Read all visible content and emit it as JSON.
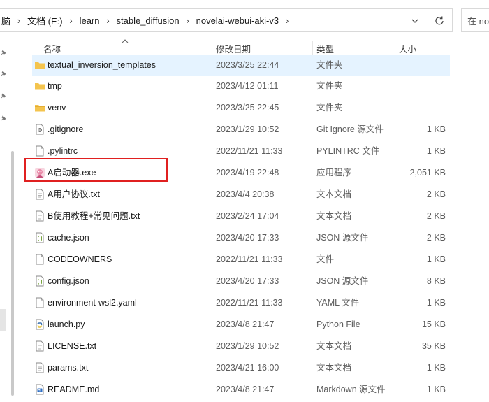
{
  "breadcrumb": [
    "脑",
    "文档 (E:)",
    "learn",
    "stable_diffusion",
    "novelai-webui-aki-v3"
  ],
  "search_placeholder": "在 no",
  "columns": {
    "name": "名称",
    "date": "修改日期",
    "type": "类型",
    "size": "大小"
  },
  "files": [
    {
      "name": "textual_inversion_templates",
      "date": "2023/3/25 22:44",
      "type": "文件夹",
      "size": "",
      "icon": "folder-icon"
    },
    {
      "name": "tmp",
      "date": "2023/4/12 01:11",
      "type": "文件夹",
      "size": "",
      "icon": "folder-icon"
    },
    {
      "name": "venv",
      "date": "2023/3/25 22:45",
      "type": "文件夹",
      "size": "",
      "icon": "folder-icon"
    },
    {
      "name": ".gitignore",
      "date": "2023/1/29 10:52",
      "type": "Git Ignore 源文件",
      "size": "1 KB",
      "icon": "gear-file-icon"
    },
    {
      "name": ".pylintrc",
      "date": "2022/11/21 11:33",
      "type": "PYLINTRC 文件",
      "size": "1 KB",
      "icon": "file-icon"
    },
    {
      "name": "A启动器.exe",
      "date": "2023/4/19 22:48",
      "type": "应用程序",
      "size": "2,051 KB",
      "icon": "app-icon"
    },
    {
      "name": "A用户协议.txt",
      "date": "2023/4/4 20:38",
      "type": "文本文档",
      "size": "2 KB",
      "icon": "text-file-icon"
    },
    {
      "name": "B使用教程+常见问题.txt",
      "date": "2023/2/24 17:04",
      "type": "文本文档",
      "size": "2 KB",
      "icon": "text-file-icon"
    },
    {
      "name": "cache.json",
      "date": "2023/4/20 17:33",
      "type": "JSON 源文件",
      "size": "2 KB",
      "icon": "json-file-icon"
    },
    {
      "name": "CODEOWNERS",
      "date": "2022/11/21 11:33",
      "type": "文件",
      "size": "1 KB",
      "icon": "file-icon"
    },
    {
      "name": "config.json",
      "date": "2023/4/20 17:33",
      "type": "JSON 源文件",
      "size": "8 KB",
      "icon": "json-file-icon"
    },
    {
      "name": "environment-wsl2.yaml",
      "date": "2022/11/21 11:33",
      "type": "YAML 文件",
      "size": "1 KB",
      "icon": "file-icon"
    },
    {
      "name": "launch.py",
      "date": "2023/4/8 21:47",
      "type": "Python File",
      "size": "15 KB",
      "icon": "python-file-icon"
    },
    {
      "name": "LICENSE.txt",
      "date": "2023/1/29 10:52",
      "type": "文本文档",
      "size": "35 KB",
      "icon": "text-file-icon"
    },
    {
      "name": "params.txt",
      "date": "2023/4/21 16:00",
      "type": "文本文档",
      "size": "1 KB",
      "icon": "text-file-icon"
    },
    {
      "name": "README.md",
      "date": "2023/4/8 21:47",
      "type": "Markdown 源文件",
      "size": "1 KB",
      "icon": "markdown-file-icon"
    }
  ],
  "colors": {
    "highlight_row": "#e5f3ff",
    "annotation_box": "#e02020",
    "folder": "#f4c44e"
  }
}
